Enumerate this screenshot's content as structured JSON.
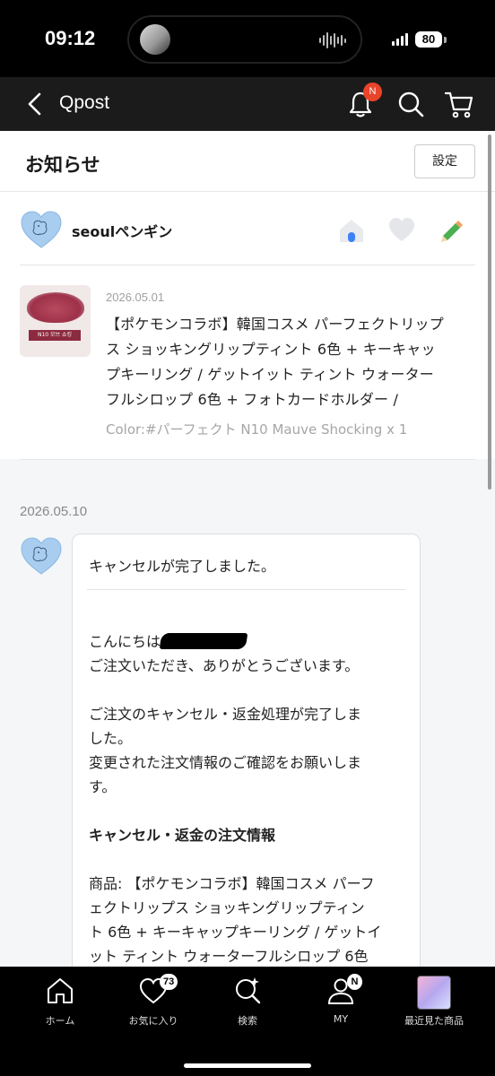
{
  "status_bar": {
    "time": "09:12",
    "battery": "80"
  },
  "header": {
    "title": "Qpost",
    "bell_badge": "N"
  },
  "notice": {
    "title": "お知らせ",
    "settings_label": "設定",
    "shop_name": "seoulペンギン",
    "product": {
      "date": "2026.05.01",
      "name": "【ポケモンコラボ】韓国コスメ パーフェクトリップス ショッキングリップティント 6色 + キーキャップキーリング / ゲットイット ティント ウォーターフルシロップ 6色 + フォトカードホルダー /",
      "option": "Color:#パーフェクト N10 Mauve Shocking x 1",
      "thumb_label": "N10 모브 쇼킹"
    }
  },
  "message": {
    "date": "2026.05.10",
    "head": "キャンセルが完了しました。",
    "greeting": "こんにちは",
    "thanks": "ご注文いただき、ありがとうございます。",
    "done_line1": "ご注文のキャンセル・返金処理が完了しま",
    "done_line2": "した。",
    "confirm_line1": "変更された注文情報のご確認をお願いしま",
    "confirm_line2": "す。",
    "section_title": "キャンセル・返金の注文情報",
    "item_line1": "商品: 【ポケモンコラボ】韓国コスメ パーフ",
    "item_line2": "ェクトリップス ショッキングリップティン",
    "item_line3": "ト 6色 + キーキャップキーリング / ゲットイ",
    "item_line4": "ット ティント ウォーターフルシロップ 6色"
  },
  "tabbar": {
    "home": "ホーム",
    "favorites": "お気に入り",
    "favorites_badge": "73",
    "search": "検索",
    "my": "MY",
    "my_badge": "N",
    "recent": "最近見た商品"
  },
  "colors": {
    "accent_badge": "#e8442a",
    "header_bg": "#1b1b1b",
    "house_icon": "#3b82f6",
    "pencil_icon": "#4caf50"
  }
}
